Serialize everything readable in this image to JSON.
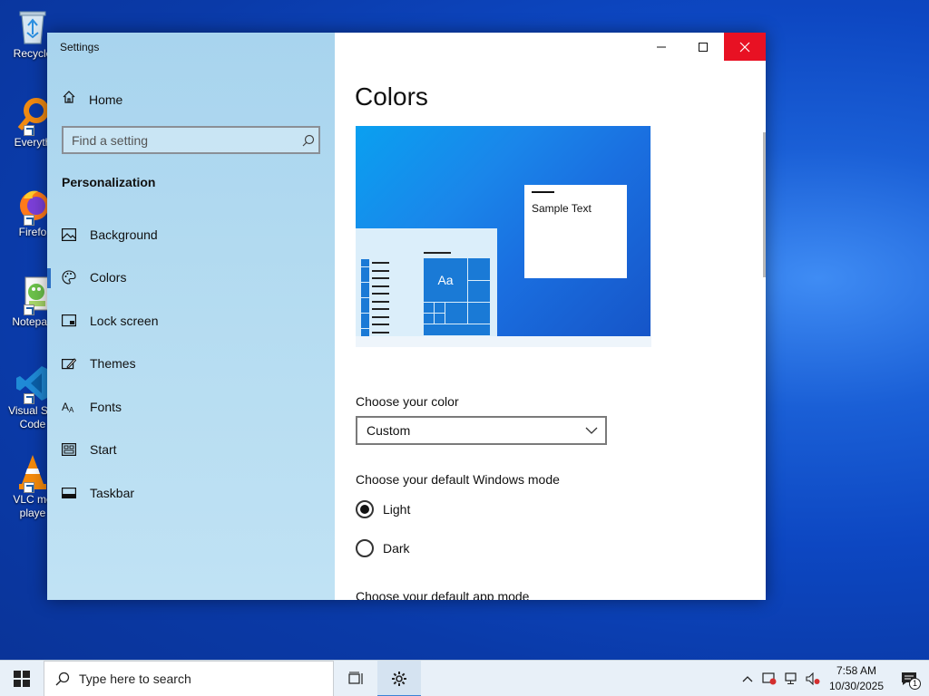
{
  "desktop": {
    "icons": [
      {
        "label": "Recycle",
        "name": "recycle-bin"
      },
      {
        "label": "Everyth",
        "name": "everything"
      },
      {
        "label": "Firefo",
        "name": "firefox"
      },
      {
        "label": "Notepad",
        "name": "notepad"
      },
      {
        "label_line1": "Visual Stu",
        "label_line2": "Code",
        "name": "visual-studio-code"
      },
      {
        "label_line1": "VLC me",
        "label_line2": "playe",
        "name": "vlc-media-player"
      }
    ]
  },
  "window": {
    "title": "Settings",
    "nav": {
      "home_label": "Home",
      "search_placeholder": "Find a setting",
      "section_title": "Personalization",
      "items": [
        {
          "label": "Background",
          "icon": "picture-icon"
        },
        {
          "label": "Colors",
          "icon": "palette-icon",
          "selected": true
        },
        {
          "label": "Lock screen",
          "icon": "lock-screen-icon"
        },
        {
          "label": "Themes",
          "icon": "themes-icon"
        },
        {
          "label": "Fonts",
          "icon": "fonts-icon"
        },
        {
          "label": "Start",
          "icon": "start-icon"
        },
        {
          "label": "Taskbar",
          "icon": "taskbar-icon"
        }
      ]
    },
    "content": {
      "page_title": "Colors",
      "preview": {
        "sample_text": "Sample Text",
        "tile_text": "Aa"
      },
      "choose_color_label": "Choose your color",
      "choose_color_value": "Custom",
      "windows_mode_label": "Choose your default Windows mode",
      "windows_mode_options": [
        {
          "label": "Light",
          "checked": true
        },
        {
          "label": "Dark",
          "checked": false
        }
      ],
      "app_mode_label": "Choose your default app mode"
    }
  },
  "taskbar": {
    "search_placeholder": "Type here to search",
    "clock": {
      "time": "7:58 AM",
      "date": "10/30/2025"
    },
    "notification_count": "1"
  },
  "colors": {
    "accent": "#1a7ad6",
    "close_button": "#e81123"
  }
}
